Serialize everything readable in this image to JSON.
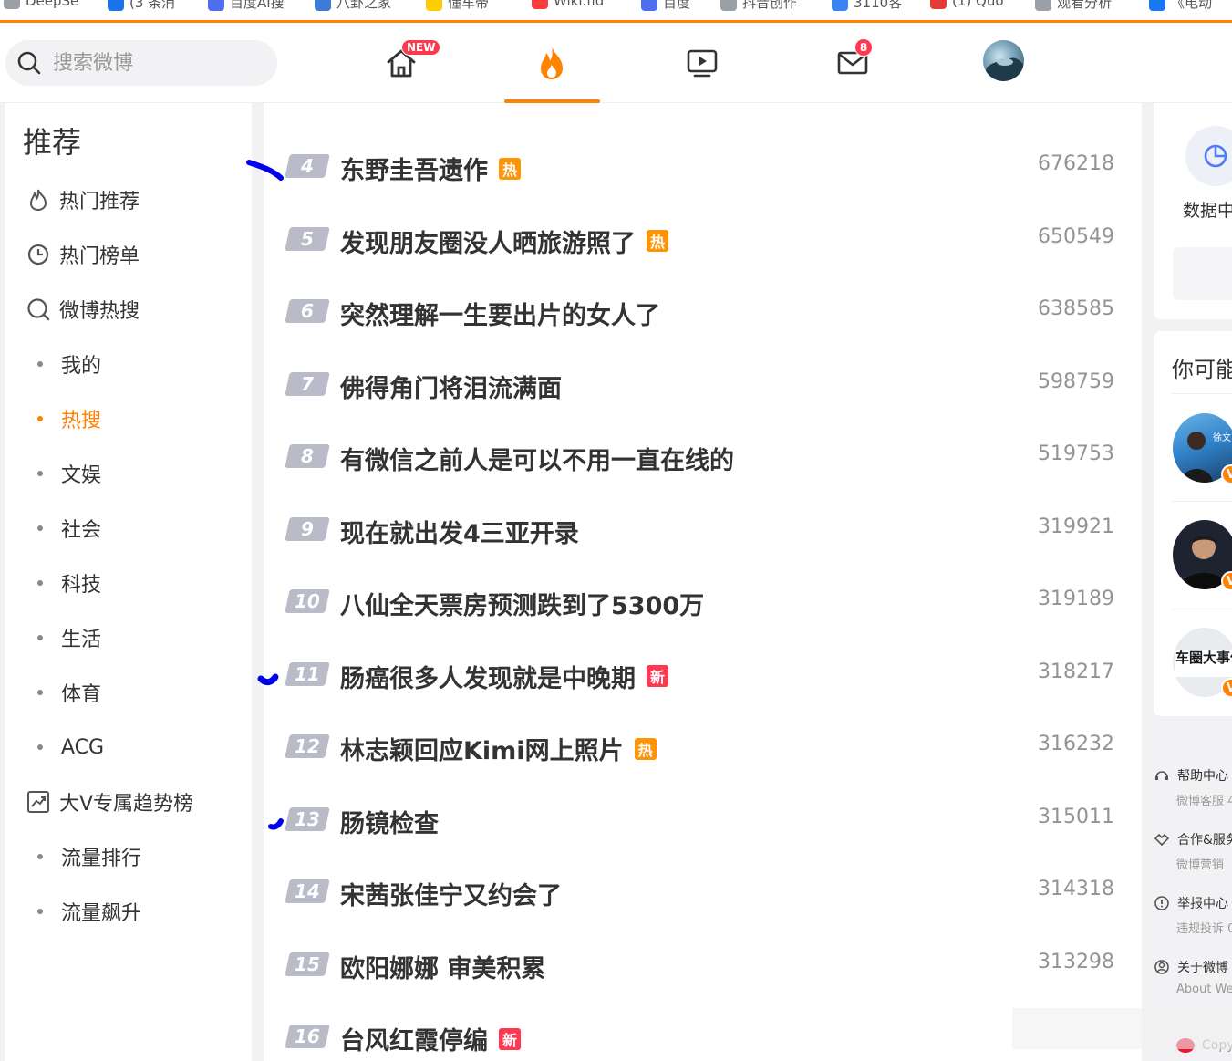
{
  "bookmarks": [
    {
      "label": "DeepSe",
      "color": "#9aa0a6"
    },
    {
      "label": "(3 条消",
      "color": "#1a73e8"
    },
    {
      "label": "百度AI搜",
      "color": "#4e6ef2"
    },
    {
      "label": "八卦之家",
      "color": "#3d7bd9"
    },
    {
      "label": "懂车帝",
      "color": "#ffcc00"
    },
    {
      "label": "Wiki.fid",
      "color": "#ff3b3b"
    },
    {
      "label": "百度",
      "color": "#4e6ef2"
    },
    {
      "label": "抖音创作",
      "color": "#9aa0a6"
    },
    {
      "label": "3110客",
      "color": "#3b82f6"
    },
    {
      "label": "(1) Quo",
      "color": "#e53935"
    },
    {
      "label": "观看分析",
      "color": "#9aa0a6"
    },
    {
      "label": "《电动",
      "color": "#1877f2"
    }
  ],
  "search": {
    "placeholder": "搜索微博"
  },
  "nav": {
    "home_badge": "NEW",
    "mail_badge": "8",
    "accent": "#ff8200"
  },
  "sidebar": {
    "title": "推荐",
    "items": [
      {
        "label": "热门推荐",
        "icon": "fire-outline-icon"
      },
      {
        "label": "热门榜单",
        "icon": "clock-rank-icon"
      },
      {
        "label": "微博热搜",
        "icon": "search-hot-icon"
      }
    ],
    "sub_items": [
      "我的",
      "热搜",
      "文娱",
      "社会",
      "科技",
      "生活",
      "体育",
      "ACG"
    ],
    "active": "热搜",
    "bigv": {
      "label": "大V专属趋势榜",
      "icon": "trend-chart-icon"
    },
    "bigv_sub": [
      "流量排行",
      "流量飙升"
    ]
  },
  "hot_list": [
    {
      "rank": "4",
      "title": "东野圭吾遗作",
      "tag": "热",
      "tag_type": "hot",
      "count": "676218"
    },
    {
      "rank": "5",
      "title": "发现朋友圈没人晒旅游照了",
      "tag": "热",
      "tag_type": "hot",
      "count": "650549"
    },
    {
      "rank": "6",
      "title": "突然理解一生要出片的女人了",
      "tag": "",
      "tag_type": "",
      "count": "638585"
    },
    {
      "rank": "7",
      "title": "佛得角门将泪流满面",
      "tag": "",
      "tag_type": "",
      "count": "598759"
    },
    {
      "rank": "8",
      "title": "有微信之前人是可以不用一直在线的",
      "tag": "",
      "tag_type": "",
      "count": "519753"
    },
    {
      "rank": "9",
      "title": "现在就出发4三亚开录",
      "tag": "",
      "tag_type": "",
      "count": "319921"
    },
    {
      "rank": "10",
      "title": "八仙全天票房预测跌到了5300万",
      "tag": "",
      "tag_type": "",
      "count": "319189"
    },
    {
      "rank": "11",
      "title": "肠癌很多人发现就是中晚期",
      "tag": "新",
      "tag_type": "new",
      "count": "318217"
    },
    {
      "rank": "12",
      "title": "林志颖回应Kimi网上照片",
      "tag": "热",
      "tag_type": "hot",
      "count": "316232"
    },
    {
      "rank": "13",
      "title": "肠镜检查",
      "tag": "",
      "tag_type": "",
      "count": "315011"
    },
    {
      "rank": "14",
      "title": "宋茜张佳宁又约会了",
      "tag": "",
      "tag_type": "",
      "count": "314318"
    },
    {
      "rank": "15",
      "title": "欧阳娜娜 审美积累",
      "tag": "",
      "tag_type": "",
      "count": "313298"
    },
    {
      "rank": "16",
      "title": "台风红霞停编",
      "tag": "新",
      "tag_type": "new",
      "count": ""
    }
  ],
  "right": {
    "data_center": "数据中",
    "maybe": "你可能",
    "avatars": [
      {
        "caption": "徐文",
        "badge": "V"
      },
      {
        "caption": "",
        "badge": "V"
      },
      {
        "caption": "车圈大事件",
        "badge": "V"
      }
    ],
    "footer": [
      {
        "label": "帮助中心",
        "sub": "微博客服 4",
        "icon": "headset-icon"
      },
      {
        "label": "合作&服务",
        "sub": "微博营销",
        "icon": "handshake-icon"
      },
      {
        "label": "举报中心",
        "sub": "违规投诉 0",
        "icon": "alert-circle-icon"
      },
      {
        "label": "关于微博",
        "sub": "About We",
        "icon": "user-circle-icon"
      }
    ],
    "copyright": "Copy"
  },
  "tag_colors": {
    "hot": "#ff9406",
    "new": "#ff3852"
  }
}
